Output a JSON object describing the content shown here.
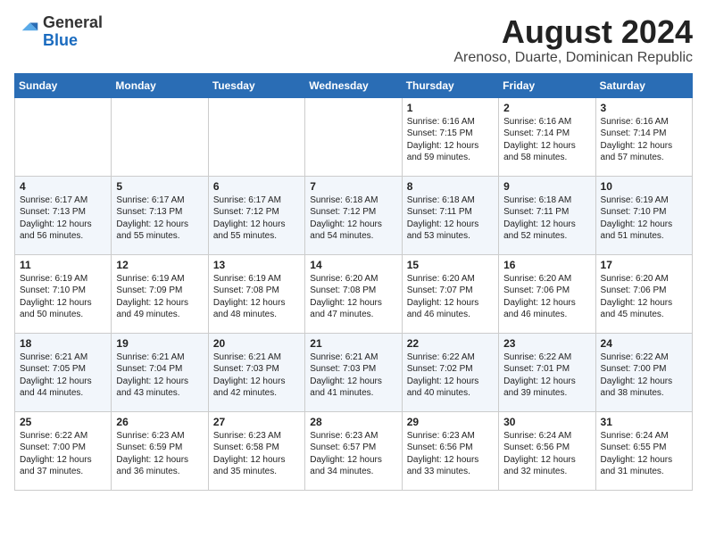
{
  "header": {
    "logo_general": "General",
    "logo_blue": "Blue",
    "month_year": "August 2024",
    "location": "Arenoso, Duarte, Dominican Republic"
  },
  "weekdays": [
    "Sunday",
    "Monday",
    "Tuesday",
    "Wednesday",
    "Thursday",
    "Friday",
    "Saturday"
  ],
  "weeks": [
    [
      {
        "day": "",
        "content": ""
      },
      {
        "day": "",
        "content": ""
      },
      {
        "day": "",
        "content": ""
      },
      {
        "day": "",
        "content": ""
      },
      {
        "day": "1",
        "content": "Sunrise: 6:16 AM\nSunset: 7:15 PM\nDaylight: 12 hours\nand 59 minutes."
      },
      {
        "day": "2",
        "content": "Sunrise: 6:16 AM\nSunset: 7:14 PM\nDaylight: 12 hours\nand 58 minutes."
      },
      {
        "day": "3",
        "content": "Sunrise: 6:16 AM\nSunset: 7:14 PM\nDaylight: 12 hours\nand 57 minutes."
      }
    ],
    [
      {
        "day": "4",
        "content": "Sunrise: 6:17 AM\nSunset: 7:13 PM\nDaylight: 12 hours\nand 56 minutes."
      },
      {
        "day": "5",
        "content": "Sunrise: 6:17 AM\nSunset: 7:13 PM\nDaylight: 12 hours\nand 55 minutes."
      },
      {
        "day": "6",
        "content": "Sunrise: 6:17 AM\nSunset: 7:12 PM\nDaylight: 12 hours\nand 55 minutes."
      },
      {
        "day": "7",
        "content": "Sunrise: 6:18 AM\nSunset: 7:12 PM\nDaylight: 12 hours\nand 54 minutes."
      },
      {
        "day": "8",
        "content": "Sunrise: 6:18 AM\nSunset: 7:11 PM\nDaylight: 12 hours\nand 53 minutes."
      },
      {
        "day": "9",
        "content": "Sunrise: 6:18 AM\nSunset: 7:11 PM\nDaylight: 12 hours\nand 52 minutes."
      },
      {
        "day": "10",
        "content": "Sunrise: 6:19 AM\nSunset: 7:10 PM\nDaylight: 12 hours\nand 51 minutes."
      }
    ],
    [
      {
        "day": "11",
        "content": "Sunrise: 6:19 AM\nSunset: 7:10 PM\nDaylight: 12 hours\nand 50 minutes."
      },
      {
        "day": "12",
        "content": "Sunrise: 6:19 AM\nSunset: 7:09 PM\nDaylight: 12 hours\nand 49 minutes."
      },
      {
        "day": "13",
        "content": "Sunrise: 6:19 AM\nSunset: 7:08 PM\nDaylight: 12 hours\nand 48 minutes."
      },
      {
        "day": "14",
        "content": "Sunrise: 6:20 AM\nSunset: 7:08 PM\nDaylight: 12 hours\nand 47 minutes."
      },
      {
        "day": "15",
        "content": "Sunrise: 6:20 AM\nSunset: 7:07 PM\nDaylight: 12 hours\nand 46 minutes."
      },
      {
        "day": "16",
        "content": "Sunrise: 6:20 AM\nSunset: 7:06 PM\nDaylight: 12 hours\nand 46 minutes."
      },
      {
        "day": "17",
        "content": "Sunrise: 6:20 AM\nSunset: 7:06 PM\nDaylight: 12 hours\nand 45 minutes."
      }
    ],
    [
      {
        "day": "18",
        "content": "Sunrise: 6:21 AM\nSunset: 7:05 PM\nDaylight: 12 hours\nand 44 minutes."
      },
      {
        "day": "19",
        "content": "Sunrise: 6:21 AM\nSunset: 7:04 PM\nDaylight: 12 hours\nand 43 minutes."
      },
      {
        "day": "20",
        "content": "Sunrise: 6:21 AM\nSunset: 7:03 PM\nDaylight: 12 hours\nand 42 minutes."
      },
      {
        "day": "21",
        "content": "Sunrise: 6:21 AM\nSunset: 7:03 PM\nDaylight: 12 hours\nand 41 minutes."
      },
      {
        "day": "22",
        "content": "Sunrise: 6:22 AM\nSunset: 7:02 PM\nDaylight: 12 hours\nand 40 minutes."
      },
      {
        "day": "23",
        "content": "Sunrise: 6:22 AM\nSunset: 7:01 PM\nDaylight: 12 hours\nand 39 minutes."
      },
      {
        "day": "24",
        "content": "Sunrise: 6:22 AM\nSunset: 7:00 PM\nDaylight: 12 hours\nand 38 minutes."
      }
    ],
    [
      {
        "day": "25",
        "content": "Sunrise: 6:22 AM\nSunset: 7:00 PM\nDaylight: 12 hours\nand 37 minutes."
      },
      {
        "day": "26",
        "content": "Sunrise: 6:23 AM\nSunset: 6:59 PM\nDaylight: 12 hours\nand 36 minutes."
      },
      {
        "day": "27",
        "content": "Sunrise: 6:23 AM\nSunset: 6:58 PM\nDaylight: 12 hours\nand 35 minutes."
      },
      {
        "day": "28",
        "content": "Sunrise: 6:23 AM\nSunset: 6:57 PM\nDaylight: 12 hours\nand 34 minutes."
      },
      {
        "day": "29",
        "content": "Sunrise: 6:23 AM\nSunset: 6:56 PM\nDaylight: 12 hours\nand 33 minutes."
      },
      {
        "day": "30",
        "content": "Sunrise: 6:24 AM\nSunset: 6:56 PM\nDaylight: 12 hours\nand 32 minutes."
      },
      {
        "day": "31",
        "content": "Sunrise: 6:24 AM\nSunset: 6:55 PM\nDaylight: 12 hours\nand 31 minutes."
      }
    ]
  ]
}
